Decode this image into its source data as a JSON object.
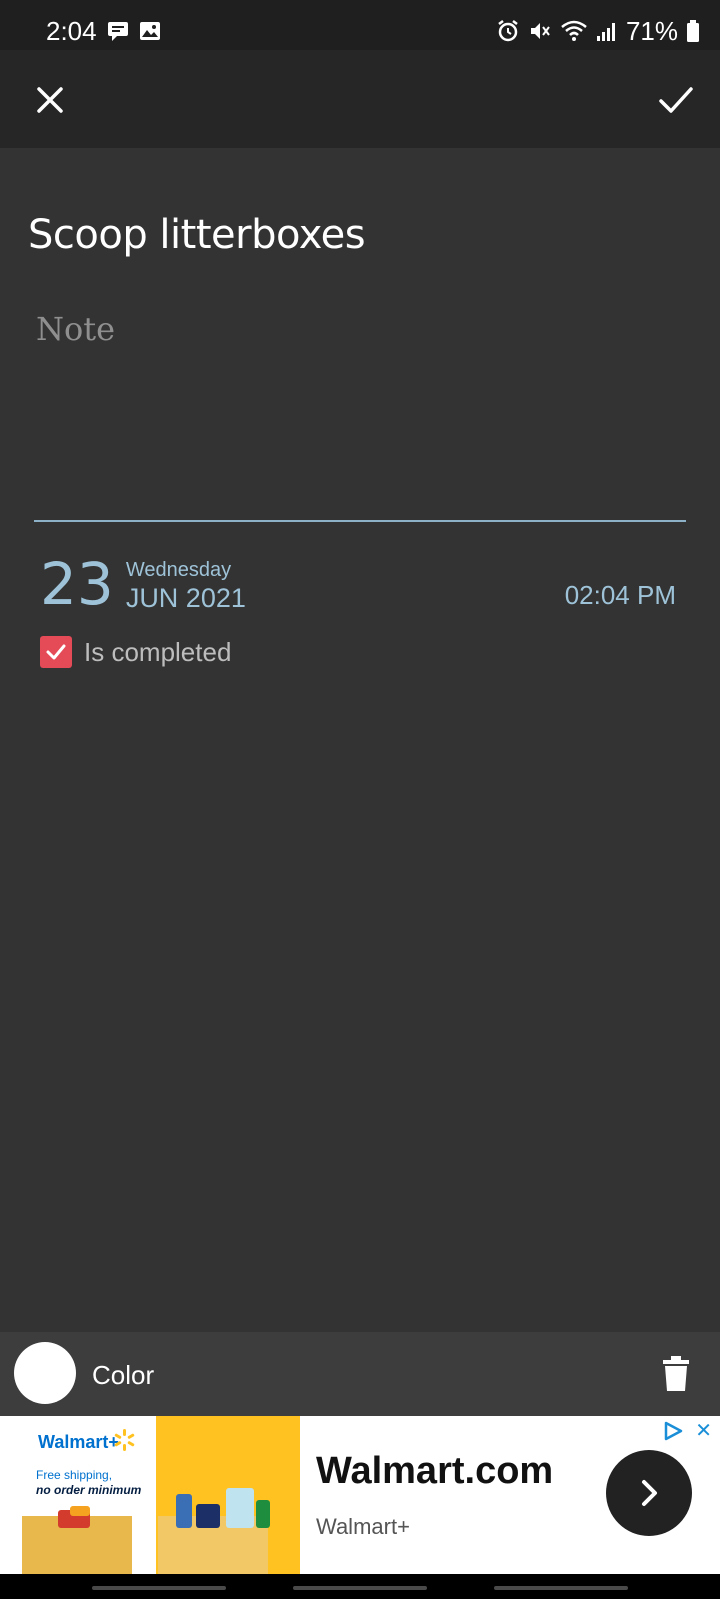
{
  "status": {
    "time": "2:04",
    "battery": "71%"
  },
  "task": {
    "title": "Scoop litterboxes",
    "note_placeholder": "Note",
    "note_value": ""
  },
  "date": {
    "day": "23",
    "weekday": "Wednesday",
    "month_year": "JUN 2021",
    "time": "02:04 PM"
  },
  "completed": {
    "label": "Is completed",
    "checked": true
  },
  "bottom": {
    "color_label": "Color"
  },
  "ad": {
    "brand_logo": "Walmart+",
    "shipping_line1": "Free shipping,",
    "shipping_line2": "no order minimum",
    "headline": "Walmart.com",
    "subtitle": "Walmart+",
    "close": "✕"
  },
  "colors": {
    "background": "#333333",
    "app_bar": "#262626",
    "accent_blue": "#9ec3d8",
    "checkbox_red": "#e44b57",
    "bottom_bar": "#3d3d3d"
  },
  "icons": {
    "close": "close-icon",
    "confirm": "check-icon",
    "delete": "trash-icon",
    "ad_next": "chevron-right-icon"
  }
}
